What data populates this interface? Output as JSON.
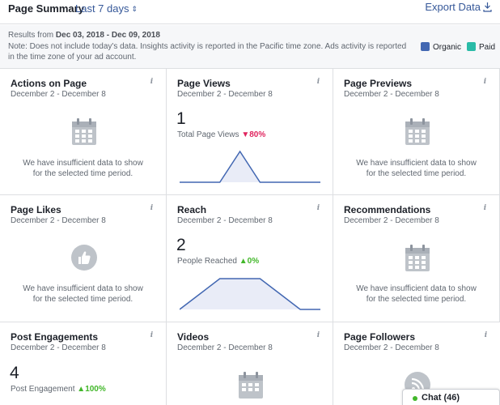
{
  "header": {
    "title": "Page Summary",
    "range_label": "Last 7 days",
    "export_label": "Export Data"
  },
  "info": {
    "results_prefix": "Results from",
    "date_range": "Dec 03, 2018 - Dec 09, 2018",
    "note": "Note: Does not include today's data. Insights activity is reported in the Pacific time zone. Ads activity is reported in the time zone of your ad account.",
    "legend": [
      {
        "label": "Organic",
        "color": "#4267b2"
      },
      {
        "label": "Paid",
        "color": "#2abba7"
      }
    ]
  },
  "empty_message": "We have insufficient data to show for the selected time period.",
  "cards": {
    "actions": {
      "title": "Actions on Page",
      "subtitle": "December 2 - December 8"
    },
    "views": {
      "title": "Page Views",
      "subtitle": "December 2 - December 8",
      "value": "1",
      "metric_label": "Total Page Views",
      "change": "80%",
      "change_dir": "down"
    },
    "previews": {
      "title": "Page Previews",
      "subtitle": "December 2 - December 8"
    },
    "likes": {
      "title": "Page Likes",
      "subtitle": "December 2 - December 8"
    },
    "reach": {
      "title": "Reach",
      "subtitle": "December 2 - December 8",
      "value": "2",
      "metric_label": "People Reached",
      "change": "0%",
      "change_dir": "up"
    },
    "recommendations": {
      "title": "Recommendations",
      "subtitle": "December 2 - December 8"
    },
    "engagements": {
      "title": "Post Engagements",
      "subtitle": "December 2 - December 8",
      "value": "4",
      "metric_label": "Post Engagement",
      "change": "100%",
      "change_dir": "up"
    },
    "videos": {
      "title": "Videos",
      "subtitle": "December 2 - December 8"
    },
    "followers": {
      "title": "Page Followers",
      "subtitle": "December 2 - December 8"
    }
  },
  "chart_data": [
    {
      "type": "area",
      "values": [
        0,
        0,
        0,
        1,
        0,
        0,
        0,
        0
      ],
      "ylim": [
        0,
        1
      ]
    },
    {
      "type": "area",
      "values": [
        0,
        0.5,
        1,
        1,
        1,
        0.5,
        0,
        0
      ],
      "ylim": [
        0,
        1
      ]
    }
  ],
  "chat": {
    "label": "Chat (46)"
  },
  "colors": {
    "link": "#365899",
    "line": "#4267b2",
    "fill": "#e9ecf7",
    "decrease": "#e0245e",
    "increase": "#42b72a"
  }
}
